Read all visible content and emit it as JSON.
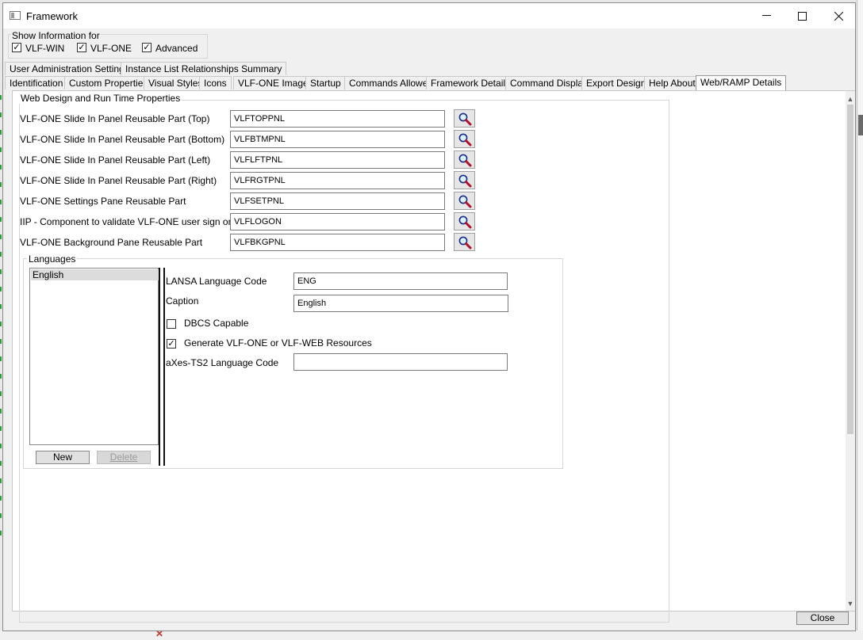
{
  "window": {
    "title": "Framework",
    "minimize_glyph": "—",
    "maximize_glyph": "☐",
    "close_glyph": "✕"
  },
  "show_info": {
    "label": "Show Information for",
    "options": [
      {
        "label": "VLF-WIN",
        "checked": true
      },
      {
        "label": "VLF-ONE",
        "checked": true
      },
      {
        "label": "Advanced",
        "checked": true
      }
    ]
  },
  "tabs_row1": [
    "User Administration Settings",
    "Instance List Relationships Summary"
  ],
  "tabs_row2": [
    "Identification",
    "Custom Properties",
    "Visual Styles",
    "Icons",
    "VLF-ONE Images",
    "Startup",
    "Commands Allowed",
    "Framework Details",
    "Command Display",
    "Export Design",
    "Help About",
    "Web/RAMP Details"
  ],
  "active_tab": "Web/RAMP Details",
  "web_group": {
    "legend": "Web Design and Run Time Properties",
    "rows": [
      {
        "label": "VLF-ONE Slide In Panel Reusable Part (Top)",
        "value": "VLFTOPPNL"
      },
      {
        "label": "VLF-ONE Slide In Panel Reusable Part (Bottom)",
        "value": "VLFBTMPNL"
      },
      {
        "label": "VLF-ONE Slide In Panel Reusable Part (Left)",
        "value": "VLFLFTPNL"
      },
      {
        "label": "VLF-ONE Slide In Panel Reusable Part (Right)",
        "value": "VLFRGTPNL"
      },
      {
        "label": "VLF-ONE Settings Pane Reusable Part",
        "value": "VLFSETPNL"
      },
      {
        "label": "IIP - Component to validate VLF-ONE user sign on",
        "value": "VLFLOGON"
      },
      {
        "label": "VLF-ONE Background Pane Reusable Part",
        "value": "VLFBKGPNL"
      }
    ]
  },
  "languages": {
    "legend": "Languages",
    "list": [
      "English"
    ],
    "selected": "English",
    "new_label": "New",
    "delete_label": "Delete",
    "lansa_code_label": "LANSA Language Code",
    "lansa_code_value": "ENG",
    "caption_label": "Caption",
    "caption_value": "English",
    "dbcs_label": "DBCS Capable",
    "dbcs_checked": false,
    "generate_label": "Generate VLF-ONE or VLF-WEB Resources",
    "generate_checked": true,
    "axes_label": "aXes-TS2 Language Code",
    "axes_value": ""
  },
  "close_label": "Close",
  "icons": {
    "lookup": "magnifier-icon",
    "check": "checkmark-icon",
    "scroll_up": "▲",
    "scroll_down": "▼"
  }
}
